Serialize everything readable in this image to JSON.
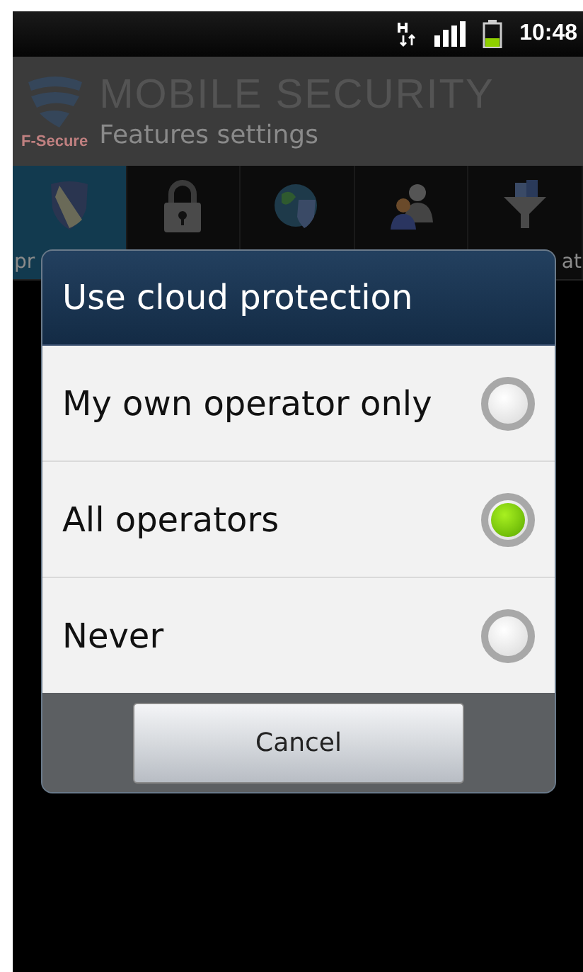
{
  "status_bar": {
    "time": "10:48"
  },
  "app_header": {
    "logo_text": "F-Secure",
    "title": "MOBILE SECURITY",
    "subtitle": "Features settings"
  },
  "tabs": [
    {
      "label": "pr",
      "selected": true
    },
    {
      "selected": false
    },
    {
      "selected": false
    },
    {
      "selected": false
    },
    {
      "label": "at",
      "selected": false
    }
  ],
  "dialog": {
    "title": "Use cloud protection",
    "options": [
      {
        "label": "My own operator only",
        "selected": false
      },
      {
        "label": "All operators",
        "selected": true
      },
      {
        "label": "Never",
        "selected": false
      }
    ],
    "buttons": [
      "Cancel"
    ]
  }
}
